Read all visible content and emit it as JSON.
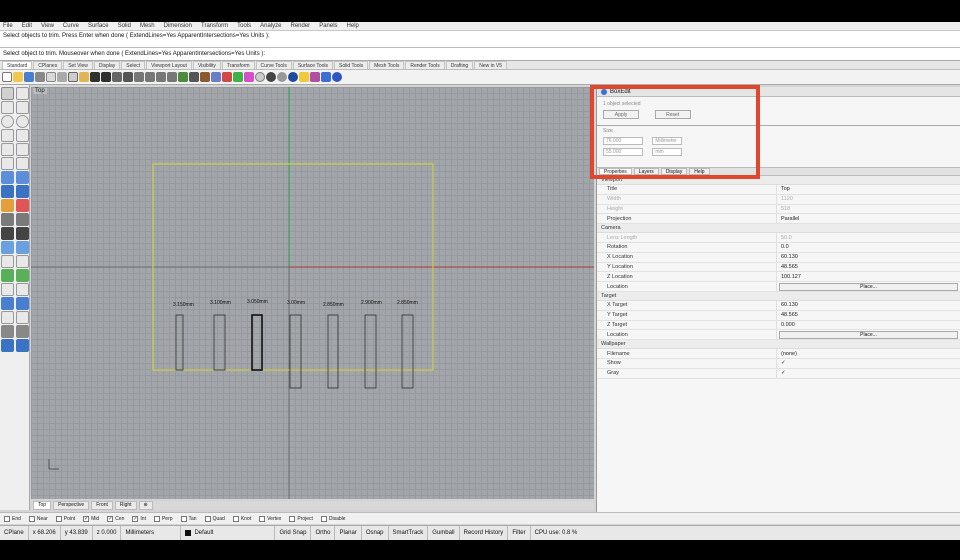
{
  "menu": [
    "File",
    "Edit",
    "View",
    "Curve",
    "Surface",
    "Solid",
    "Mesh",
    "Dimension",
    "Transform",
    "Tools",
    "Analyze",
    "Render",
    "Panels",
    "Help"
  ],
  "command_history": [
    "Select objects to trim. Press Enter when done ( ExtendLines=Yes  ApparentIntersections=Yes  Units ):"
  ],
  "command_prompt": "Select object to trim. Mouseover when done ( ExtendLines=Yes ApparentIntersections=Yes Units ):",
  "toolbar_tabs": [
    "Standard",
    "CPlanes",
    "Set View",
    "Display",
    "Select",
    "Viewport Layout",
    "Visibility",
    "Transform",
    "Curve Tools",
    "Surface Tools",
    "Solid Tools",
    "Mesh Tools",
    "Render Tools",
    "Drafting",
    "New in V5"
  ],
  "active_tab": "Standard",
  "viewport": {
    "title": "Top",
    "labels": [
      "3.150mm",
      "3.100mm",
      "3.050mm",
      "3.00mm",
      "2.850mm",
      "2.900mm",
      "2.850mm"
    ]
  },
  "viewport_tabs": [
    "Top",
    "Perspective",
    "Front",
    "Right"
  ],
  "osnaps": [
    {
      "label": "End",
      "checked": false
    },
    {
      "label": "Near",
      "checked": false
    },
    {
      "label": "Point",
      "checked": false
    },
    {
      "label": "Mid",
      "checked": true
    },
    {
      "label": "Cen",
      "checked": true
    },
    {
      "label": "Int",
      "checked": true
    },
    {
      "label": "Perp",
      "checked": false
    },
    {
      "label": "Tan",
      "checked": false
    },
    {
      "label": "Quad",
      "checked": false
    },
    {
      "label": "Knot",
      "checked": false
    },
    {
      "label": "Vertex",
      "checked": false
    },
    {
      "label": "Project",
      "checked": false
    },
    {
      "label": "Disable",
      "checked": false
    }
  ],
  "status": {
    "cplane": "CPlane",
    "x": "x 68.206",
    "y": "y 43.839",
    "z": "z 0.000",
    "units": "Millimeters",
    "layer": "Default",
    "toggles": [
      "Grid Snap",
      "Ortho",
      "Planar",
      "Osnap",
      "SmartTrack",
      "Gumball",
      "Record History",
      "Filter"
    ],
    "cpu": "CPU use: 0.8 %"
  },
  "boxedit": {
    "title": "BoxEdit",
    "selected": "1 object selected",
    "apply": "Apply",
    "reset": "Reset",
    "size_label": "Size",
    "x_value": "76.000",
    "y_value": "55.000",
    "x_unit": "Millimeter",
    "y_unit": "mm"
  },
  "props_tabs": [
    "Properties",
    "Layers",
    "Display",
    "Help"
  ],
  "props": {
    "viewport_section": "Viewport",
    "title_k": "Title",
    "title_v": "Top",
    "width_k": "Width",
    "width_v": "1120",
    "height_k": "Height",
    "height_v": "518",
    "projection_k": "Projection",
    "projection_v": "Parallel",
    "camera_section": "Camera",
    "lens_k": "Lens Length",
    "lens_v": "50.0",
    "rotation_k": "Rotation",
    "rotation_v": "0.0",
    "xloc_k": "X Location",
    "xloc_v": "60.130",
    "yloc_k": "Y Location",
    "yloc_v": "48.565",
    "zloc_k": "Z Location",
    "zloc_v": "100.127",
    "location_k": "Location",
    "place_btn": "Place...",
    "target_section": "Target",
    "xt_k": "X Target",
    "xt_v": "60.130",
    "yt_k": "Y Target",
    "yt_v": "48.565",
    "zt_k": "Z Target",
    "zt_v": "0.000",
    "tloc_k": "Location",
    "tplace_btn": "Place...",
    "wallpaper_section": "Wallpaper",
    "filename_k": "Filename",
    "filename_v": "(none)",
    "show_k": "Show",
    "show_v": "✓",
    "gray_k": "Gray",
    "gray_v": "✓"
  }
}
